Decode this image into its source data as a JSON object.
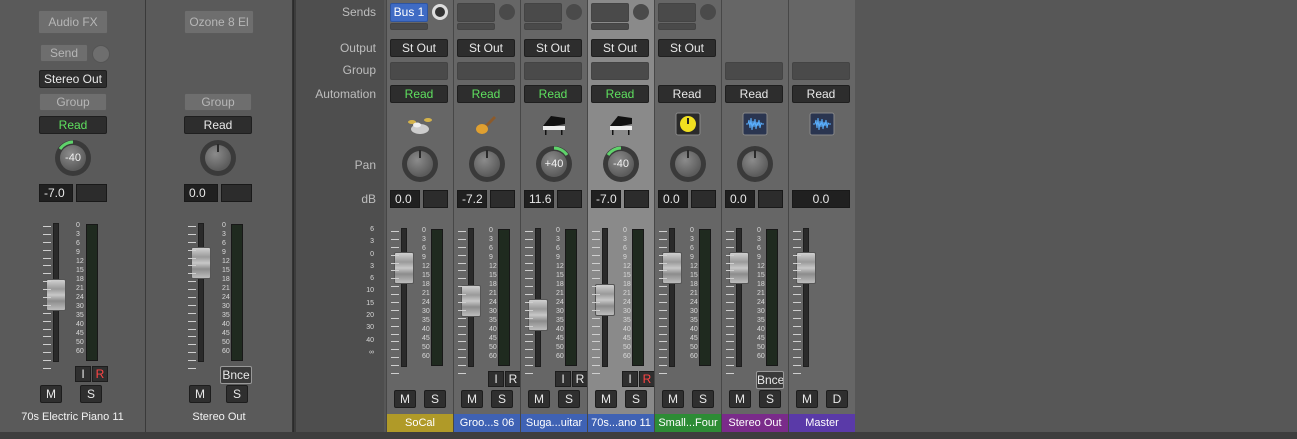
{
  "left_strips": [
    {
      "insert": "Audio FX",
      "send": "Send",
      "output": "Stereo Out",
      "group": "Group",
      "automation": "Read",
      "pan": "-40",
      "db": "-7.0",
      "mute": "M",
      "solo": "S",
      "i": "I",
      "r": "R",
      "name": "70s Electric Piano 11"
    },
    {
      "insert": "Ozone 8 El",
      "group": "Group",
      "automation": "Read",
      "db": "0.0",
      "bnce": "Bnce",
      "mute": "M",
      "solo": "S",
      "name": "Stereo Out"
    }
  ],
  "row_labels": {
    "sends": "Sends",
    "output": "Output",
    "group": "Group",
    "automation": "Automation",
    "pan": "Pan",
    "db": "dB"
  },
  "scale_left": [
    "6",
    "3",
    "0",
    "3",
    "6",
    "10",
    "15",
    "20",
    "30",
    "40",
    "∞"
  ],
  "scale_meter": [
    "0",
    "3",
    "6",
    "9",
    "12",
    "15",
    "18",
    "21",
    "24",
    "30",
    "35",
    "40",
    "45",
    "50",
    "60"
  ],
  "scale_meter_left": [
    "0",
    "3",
    "6",
    "9",
    "12",
    "15",
    "18",
    "21",
    "24",
    "30",
    "35",
    "40",
    "45",
    "50",
    "60"
  ],
  "strips": [
    {
      "send": "Bus 1",
      "output": "St Out",
      "automation": "Read",
      "db": "0.0",
      "m": "M",
      "s": "S",
      "name": "SoCal",
      "color": "#b09a28",
      "inst": "drums-icon"
    },
    {
      "output": "St Out",
      "automation": "Read",
      "db": "-7.2",
      "i": "I",
      "r": "R",
      "m": "M",
      "s": "S",
      "name": "Groo...s 06",
      "color": "#3f62b4",
      "inst": "guitar-icon"
    },
    {
      "output": "St Out",
      "automation": "Read",
      "db": "11.6",
      "pan": "+40",
      "i": "I",
      "r": "R",
      "m": "M",
      "s": "S",
      "name": "Suga...uitar",
      "color": "#3f62b4",
      "inst": "piano-icon"
    },
    {
      "output": "St Out",
      "automation": "Read",
      "db": "-7.0",
      "pan": "-40",
      "i": "I",
      "r": "R",
      "m": "M",
      "s": "S",
      "name": "70s...ano 11",
      "color": "#3f62b4",
      "inst": "piano-icon"
    },
    {
      "output": "St Out",
      "automation": "Read",
      "db": "0.0",
      "m": "M",
      "s": "S",
      "name": "Small...Four",
      "color": "#2d8c35",
      "inst": "tuner-icon"
    },
    {
      "automation": "Read",
      "db": "0.0",
      "bnce": "Bnce",
      "m": "M",
      "s": "S",
      "name": "Stereo Out",
      "color": "#7a2b8a",
      "inst": "waveform-icon"
    },
    {
      "automation": "Read",
      "db": "0.0",
      "m": "M",
      "d": "D",
      "name": "Master",
      "color": "#5a3aa8",
      "inst": "waveform-icon"
    }
  ]
}
